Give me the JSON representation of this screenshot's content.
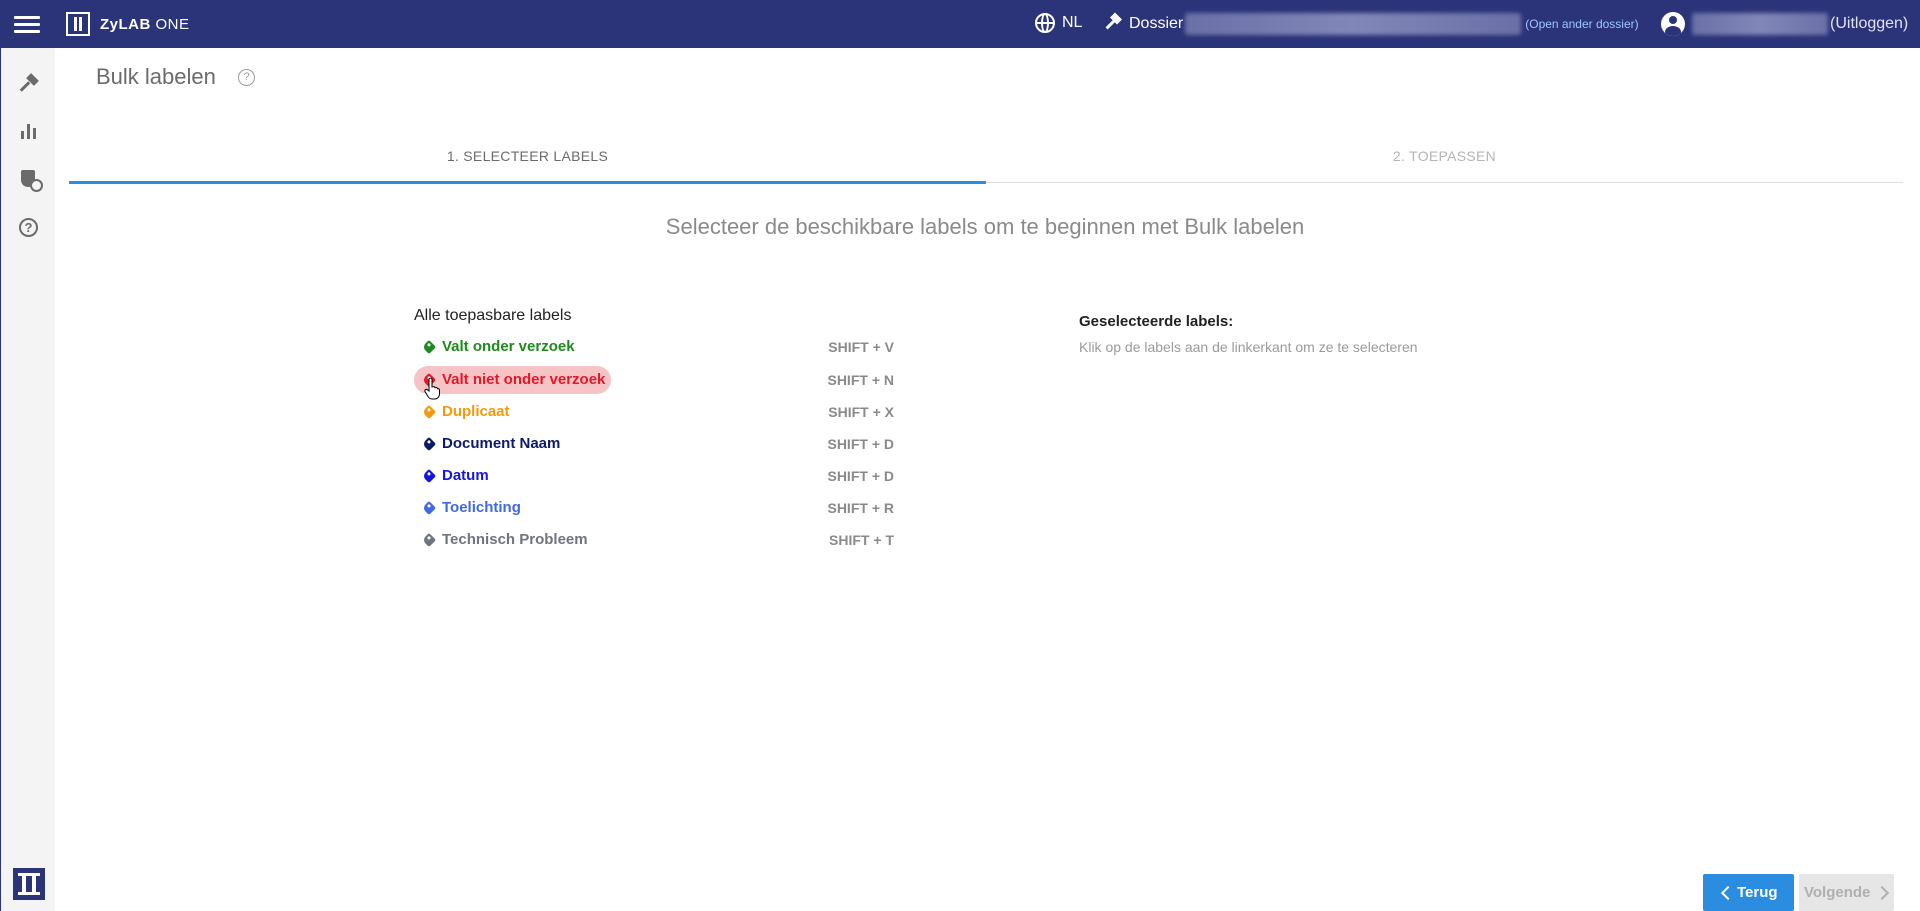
{
  "topbar": {
    "app_name_bold": "ZyLAB",
    "app_name_thin": " ONE",
    "language": "NL",
    "dossier_label": "Dossier",
    "open_other_dossier": "(Open ander dossier)",
    "logout": "(Uitloggen)"
  },
  "sidebar": {
    "items": [
      {
        "name": "Dossier",
        "icon": "gavel-icon"
      },
      {
        "name": "Rapportage",
        "icon": "bar-chart-icon"
      },
      {
        "name": "Beheer",
        "icon": "shield-settings-icon"
      },
      {
        "name": "Help",
        "icon": "help-icon"
      }
    ]
  },
  "page": {
    "title": "Bulk labelen",
    "help_glyph": "?"
  },
  "steps": [
    {
      "label": "1. SELECTEER LABELS",
      "active": true
    },
    {
      "label": "2. TOEPASSEN",
      "active": false
    }
  ],
  "headline": "Selecteer de beschikbare labels om te beginnen met Bulk labelen",
  "labels_section": {
    "heading": "Alle toepasbare labels",
    "items": [
      {
        "name": "Valt onder verzoek",
        "shortcut": "SHIFT + V",
        "color": "#1e8a1e"
      },
      {
        "name": "Valt niet onder verzoek",
        "shortcut": "SHIFT + N",
        "color": "#e0192b"
      },
      {
        "name": "Duplicaat",
        "shortcut": "SHIFT + X",
        "color": "#f29a0e"
      },
      {
        "name": "Document Naam",
        "shortcut": "SHIFT + D",
        "color": "#0c1a6e"
      },
      {
        "name": "Datum",
        "shortcut": "SHIFT + D",
        "color": "#1515e0"
      },
      {
        "name": "Toelichting",
        "shortcut": "SHIFT + R",
        "color": "#4169e1"
      },
      {
        "name": "Technisch Probleem",
        "shortcut": "SHIFT + T",
        "color": "#6e7480"
      }
    ]
  },
  "selected_section": {
    "heading": "Geselecteerde labels:",
    "hint": "Klik op de labels aan de linkerkant om ze te selecteren"
  },
  "buttons": {
    "back": "Terug",
    "next": "Volgende"
  }
}
